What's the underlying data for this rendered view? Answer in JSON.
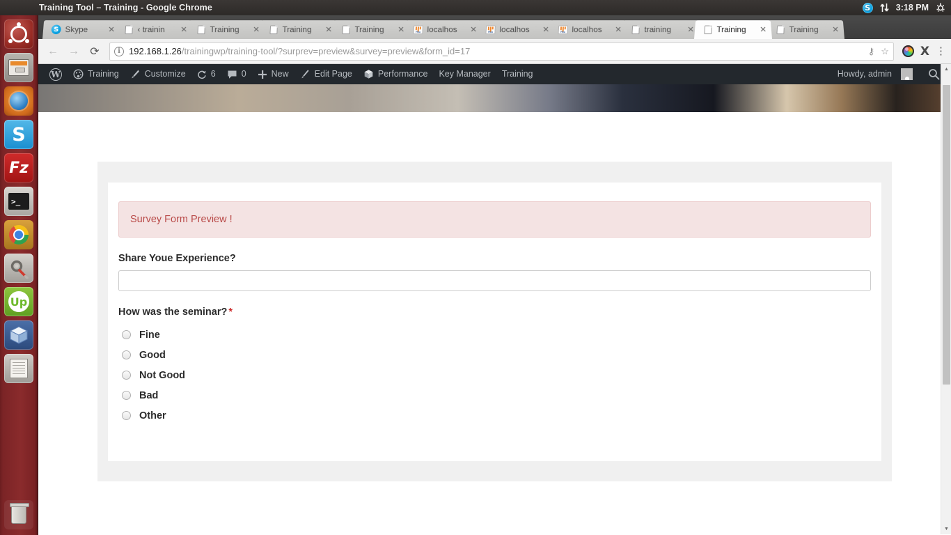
{
  "panel": {
    "window_title": "Training Tool – Training - Google Chrome",
    "clock": "3:18 PM",
    "tray": [
      {
        "name": "skype-tray-icon",
        "label": "S"
      },
      {
        "name": "network-tray-icon",
        "label": ""
      },
      {
        "name": "session-gear-icon",
        "label": ""
      }
    ]
  },
  "launcher": {
    "items": [
      {
        "name": "ubuntu-dash-icon",
        "label": "Dash home",
        "running": false,
        "focused": false
      },
      {
        "name": "files-icon",
        "label": "Files",
        "running": true,
        "focused": false
      },
      {
        "name": "firefox-icon",
        "label": "Firefox Web Browser",
        "running": true,
        "focused": false
      },
      {
        "name": "skype-icon",
        "label": "Skype",
        "running": true,
        "focused": false
      },
      {
        "name": "filezilla-icon",
        "label": "FileZilla",
        "running": false,
        "focused": false
      },
      {
        "name": "terminal-icon",
        "label": "Terminal",
        "running": true,
        "focused": false
      },
      {
        "name": "chrome-icon",
        "label": "Google Chrome",
        "running": true,
        "focused": true
      },
      {
        "name": "settings-icon",
        "label": "System Settings",
        "running": false,
        "focused": false
      },
      {
        "name": "upwork-icon",
        "label": "Upwork",
        "running": true,
        "focused": false
      },
      {
        "name": "virtualbox-icon",
        "label": "VirtualBox",
        "running": true,
        "focused": false
      },
      {
        "name": "text-editor-icon",
        "label": "Text Editor",
        "running": true,
        "focused": false
      }
    ],
    "trash_label": "Trash"
  },
  "browser": {
    "tabs": [
      {
        "title": "Skype",
        "favicon": "skype",
        "active": false
      },
      {
        "title": "‹ trainin",
        "favicon": "page",
        "active": false
      },
      {
        "title": "Training",
        "favicon": "page",
        "active": false
      },
      {
        "title": "Training",
        "favicon": "page",
        "active": false
      },
      {
        "title": "Training",
        "favicon": "page",
        "active": false
      },
      {
        "title": "localhos",
        "favicon": "pma",
        "active": false
      },
      {
        "title": "localhos",
        "favicon": "pma",
        "active": false
      },
      {
        "title": "localhos",
        "favicon": "pma",
        "active": false
      },
      {
        "title": "training",
        "favicon": "page",
        "active": false
      },
      {
        "title": "Training",
        "favicon": "page",
        "active": true
      },
      {
        "title": "Training",
        "favicon": "page",
        "active": false
      }
    ],
    "tab_close_label": "✕",
    "nav": {
      "back": "←",
      "forward": "→",
      "reload": "⟳"
    },
    "omnibox": {
      "security_icon_label": "i",
      "url_host": "192.168.1.26",
      "url_path": "/trainingwp/training-tool/?surprev=preview&survey=preview&form_id=17",
      "save_password_icon": "⚷",
      "bookmark_icon": "☆"
    },
    "extensions": [
      {
        "name": "colorpick-extension-icon",
        "label": ""
      },
      {
        "name": "extension-x-icon",
        "label": "X"
      }
    ],
    "menu_icon_label": "⋮"
  },
  "wpadminbar": {
    "logo_label": "W",
    "items": [
      {
        "name": "wp-logo-menu",
        "label": "",
        "icon": "wp"
      },
      {
        "name": "site-name-menu",
        "label": "Training",
        "icon": "dashboard"
      },
      {
        "name": "customize-menu",
        "label": "Customize",
        "icon": "brush"
      },
      {
        "name": "updates-menu",
        "label": "6",
        "icon": "updates"
      },
      {
        "name": "comments-menu",
        "label": "0",
        "icon": "comment"
      },
      {
        "name": "new-content-menu",
        "label": "New",
        "icon": "plus"
      },
      {
        "name": "edit-page-menu",
        "label": "Edit Page",
        "icon": "pencil"
      },
      {
        "name": "performance-menu",
        "label": "Performance",
        "icon": "cube"
      },
      {
        "name": "key-manager-menu",
        "label": "Key Manager",
        "icon": "none"
      },
      {
        "name": "training-menu",
        "label": "Training",
        "icon": "none"
      }
    ],
    "howdy": "Howdy, admin",
    "search_icon_label": "⚲"
  },
  "form": {
    "preview_notice": "Survey Form Preview !",
    "fields": [
      {
        "type": "text",
        "label": "Share Youe Experience?",
        "required": false,
        "value": "",
        "placeholder": ""
      },
      {
        "type": "radio",
        "label": "How was the seminar?",
        "required": true,
        "required_marker": "*",
        "options": [
          {
            "label": "Fine",
            "checked": false
          },
          {
            "label": "Good",
            "checked": false
          },
          {
            "label": "Not Good",
            "checked": false
          },
          {
            "label": "Bad",
            "checked": false
          },
          {
            "label": "Other",
            "checked": false
          }
        ]
      }
    ]
  },
  "colors": {
    "alert_bg": "#f4e3e3",
    "alert_border": "#eccccc",
    "alert_text": "#b94a48",
    "required_star": "#cc2b2b",
    "admin_bar": "#23282d",
    "launcher": "#8a2b2c",
    "card_outer": "#f0f0f0"
  }
}
